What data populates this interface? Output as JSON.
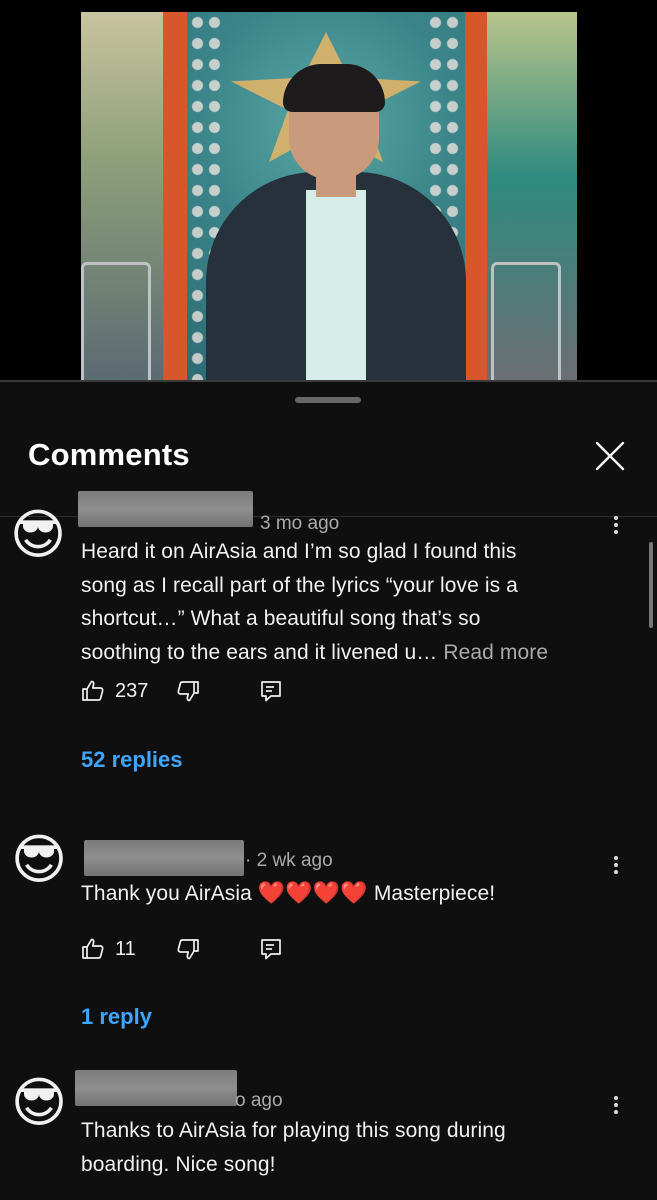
{
  "sheet": {
    "title": "Comments"
  },
  "comments": [
    {
      "time": "3 mo ago",
      "lines": [
        "Heard it on AirAsia and I’m so glad I found this",
        "song as I recall part of the lyrics “your love is a",
        "shortcut…” What a beautiful song that’s so",
        "soothing to the ears and it livened u…"
      ],
      "read_more": "Read more",
      "likes": "237",
      "replies": "52 replies",
      "avatar": "😎"
    },
    {
      "time": "· 2 wk ago",
      "text_before": "Thank you AirAsia",
      "hearts": [
        "❤️",
        "❤️",
        "❤️",
        "❤️"
      ],
      "text_after": "Masterpiece!",
      "likes": "11",
      "replies": "1 reply",
      "avatar": "😎"
    },
    {
      "time": "o ago",
      "lines": [
        "Thanks to AirAsia for playing this song during",
        "boarding. Nice song!"
      ],
      "avatar": "😎"
    }
  ],
  "icons": {
    "like": "thumbs-up-icon",
    "dislike": "thumbs-down-icon",
    "reply": "reply-icon",
    "more": "more-vert-icon",
    "close": "close-icon"
  },
  "colors": {
    "background": "#0f0f0f",
    "link_blue": "#3ea6ff",
    "secondary_text": "#aaaaaa"
  }
}
